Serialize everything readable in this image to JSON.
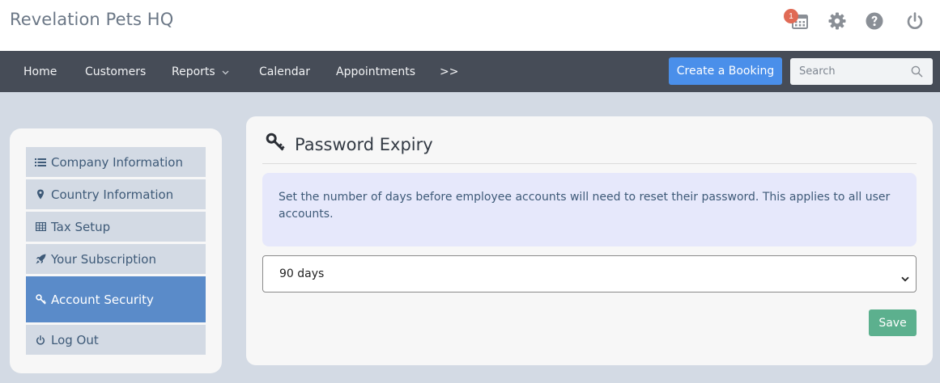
{
  "app": {
    "title": "Revelation Pets HQ",
    "notification_count": "1"
  },
  "nav": {
    "items": [
      {
        "label": "Home"
      },
      {
        "label": "Customers"
      },
      {
        "label": "Reports"
      },
      {
        "label": "Calendar"
      },
      {
        "label": "Appointments"
      },
      {
        "label": ">>"
      }
    ],
    "create_booking_label": "Create a Booking",
    "search_placeholder": "Search"
  },
  "sidebar": {
    "items": [
      {
        "label": "Company Information",
        "icon": "list-icon"
      },
      {
        "label": "Country Information",
        "icon": "map-marker-icon"
      },
      {
        "label": "Tax Setup",
        "icon": "table-icon"
      },
      {
        "label": "Your Subscription",
        "icon": "rocket-icon"
      },
      {
        "label": "Account Security",
        "icon": "key-icon",
        "active": true
      },
      {
        "label": "Log Out",
        "icon": "power-icon"
      }
    ]
  },
  "panel": {
    "title": "Password Expiry",
    "info_text": "Set the number of days before employee accounts will need to reset their password. This applies to all user accounts.",
    "expiry_value": "90 days",
    "save_label": "Save"
  },
  "colors": {
    "navbar": "#464c57",
    "primary_button": "#4a8fea",
    "active_sidebar": "#5a8bc9",
    "save_button": "#5cb08e",
    "badge": "#e06a55"
  }
}
